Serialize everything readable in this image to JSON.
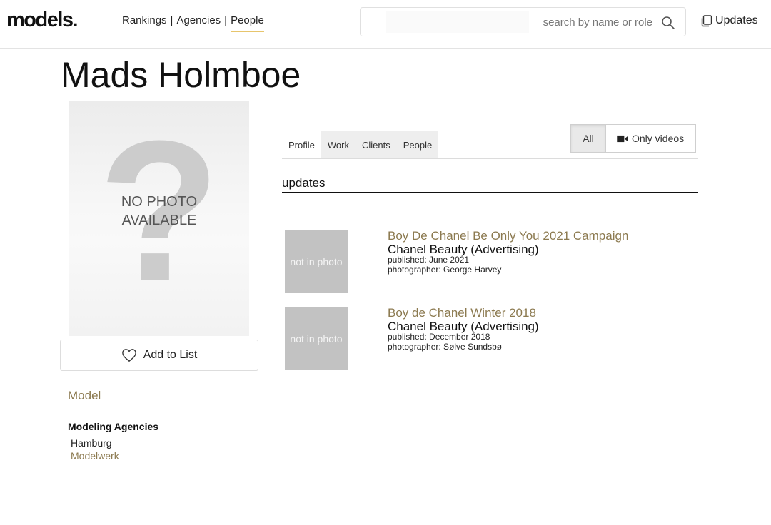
{
  "header": {
    "logo": "models.",
    "nav": [
      {
        "label": "Rankings"
      },
      {
        "label": "Agencies"
      },
      {
        "label": "People",
        "active": true
      }
    ],
    "separator": "|",
    "search_placeholder": "search by name or role",
    "updates_label": "Updates"
  },
  "page": {
    "title": "Mads Holmboe"
  },
  "photo": {
    "question_mark": "?",
    "no_photo_line1": "NO PHOTO",
    "no_photo_line2": "AVAILABLE"
  },
  "sidebar": {
    "add_to_list": "Add to List",
    "role": "Model",
    "agencies_heading": "Modeling Agencies",
    "agencies": [
      {
        "city": "Hamburg",
        "name": "Modelwerk"
      }
    ]
  },
  "tabs": [
    {
      "label": "Profile",
      "active": true
    },
    {
      "label": "Work"
    },
    {
      "label": "Clients"
    },
    {
      "label": "People"
    }
  ],
  "filter": {
    "all_label": "All",
    "videos_label": "Only videos",
    "selected": "All"
  },
  "updates": {
    "heading": "updates",
    "items": [
      {
        "thumb_text": "not in photo",
        "title": "Boy De Chanel Be Only You 2021 Campaign",
        "client": "Chanel Beauty (Advertising)",
        "published": "published: June 2021",
        "photographer": "photographer: George Harvey"
      },
      {
        "thumb_text": "not in photo",
        "title": "Boy de Chanel Winter 2018",
        "client": "Chanel Beauty (Advertising)",
        "published": "published: December 2018",
        "photographer": "photographer: Sølve Sundsbø"
      }
    ]
  },
  "colors": {
    "accent": "#8c7a50",
    "nav_underline": "#e7c56c",
    "thumb_bg": "#c2c2c2"
  },
  "icons": {
    "search": "search-icon",
    "updates": "copy-icon",
    "add_to_list": "heart-icon",
    "videos": "video-camera-icon"
  }
}
